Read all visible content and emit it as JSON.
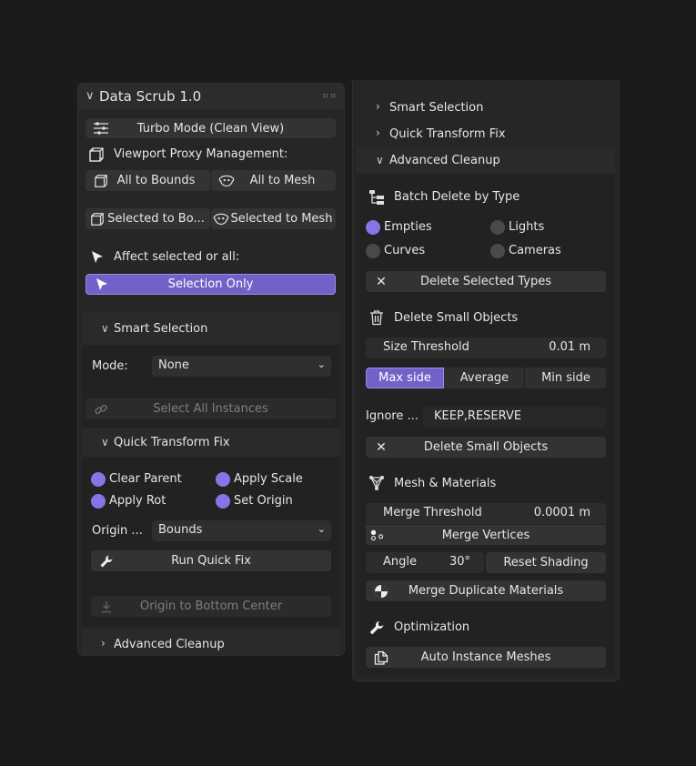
{
  "left": {
    "title": "Data Scrub 1.0",
    "turbo_mode": "Turbo Mode (Clean View)",
    "proxy_header": "Viewport Proxy Management:",
    "all_to_bounds": "All to Bounds",
    "all_to_mesh": "All to Mesh",
    "selected_to_bounds": "Selected to Bo...",
    "selected_to_mesh": "Selected to Mesh",
    "affect_label": "Affect selected or all:",
    "selection_only": "Selection Only",
    "smart_selection": "Smart Selection",
    "mode_label": "Mode:",
    "mode_value": "None",
    "select_all_instances": "Select All Instances",
    "quick_transform_fix": "Quick Transform Fix",
    "clear_parent": "Clear Parent",
    "apply_scale": "Apply Scale",
    "apply_rot": "Apply Rot",
    "set_origin": "Set Origin",
    "origin_label": "Origin ...",
    "origin_value": "Bounds",
    "run_quick_fix": "Run Quick Fix",
    "origin_bottom": "Origin to Bottom Center",
    "advanced_cleanup": "Advanced Cleanup"
  },
  "right": {
    "smart_selection": "Smart Selection",
    "quick_transform_fix": "Quick Transform Fix",
    "advanced_cleanup": "Advanced Cleanup",
    "batch_delete": "Batch Delete by Type",
    "empties": "Empties",
    "lights": "Lights",
    "curves": "Curves",
    "cameras": "Cameras",
    "delete_selected_types": "Delete Selected Types",
    "delete_small_header": "Delete Small Objects",
    "size_threshold_label": "Size Threshold",
    "size_threshold_value": "0.01 m",
    "max_side": "Max side",
    "average": "Average",
    "min_side": "Min side",
    "ignore_label": "Ignore ...",
    "ignore_value": "KEEP,RESERVE",
    "delete_small_button": "Delete Small Objects",
    "mesh_materials": "Mesh & Materials",
    "merge_threshold_label": "Merge Threshold",
    "merge_threshold_value": "0.0001 m",
    "merge_vertices": "Merge Vertices",
    "angle_label": "Angle",
    "angle_value": "30°",
    "reset_shading": "Reset Shading",
    "merge_duplicate_materials": "Merge Duplicate Materials",
    "optimization": "Optimization",
    "auto_instance": "Auto Instance Meshes"
  }
}
